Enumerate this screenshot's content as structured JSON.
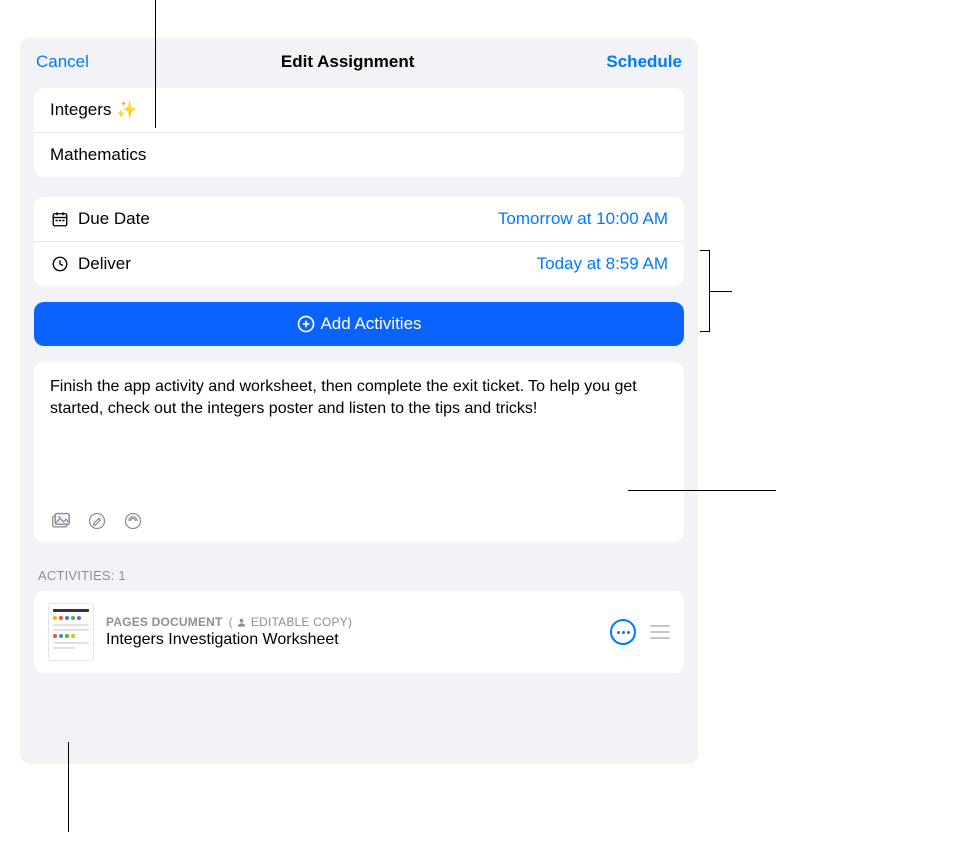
{
  "header": {
    "cancel_label": "Cancel",
    "title": "Edit Assignment",
    "schedule_label": "Schedule"
  },
  "assignment": {
    "title": "Integers ✨",
    "class_name": "Mathematics"
  },
  "dates": {
    "due_label": "Due Date",
    "due_value": "Tomorrow at 10:00 AM",
    "deliver_label": "Deliver",
    "deliver_value": "Today at 8:59 AM"
  },
  "add_activities_label": "Add Activities",
  "instructions": "Finish the app activity and worksheet, then complete the exit ticket. To help you get started, check out the integers poster and listen to the tips and tricks!",
  "activities_header": "ACTIVITIES: 1",
  "activity": {
    "type_label": "PAGES DOCUMENT",
    "copy_label": "EDITABLE COPY",
    "title": "Integers Investigation Worksheet"
  },
  "icons": {
    "calendar": "calendar-icon",
    "clock": "clock-icon",
    "plus_circle": "plus-circle-icon",
    "photo": "photo-icon",
    "draw": "draw-icon",
    "audio": "audio-icon",
    "person": "person-icon",
    "more": "more-icon",
    "drag": "drag-handle-icon"
  }
}
